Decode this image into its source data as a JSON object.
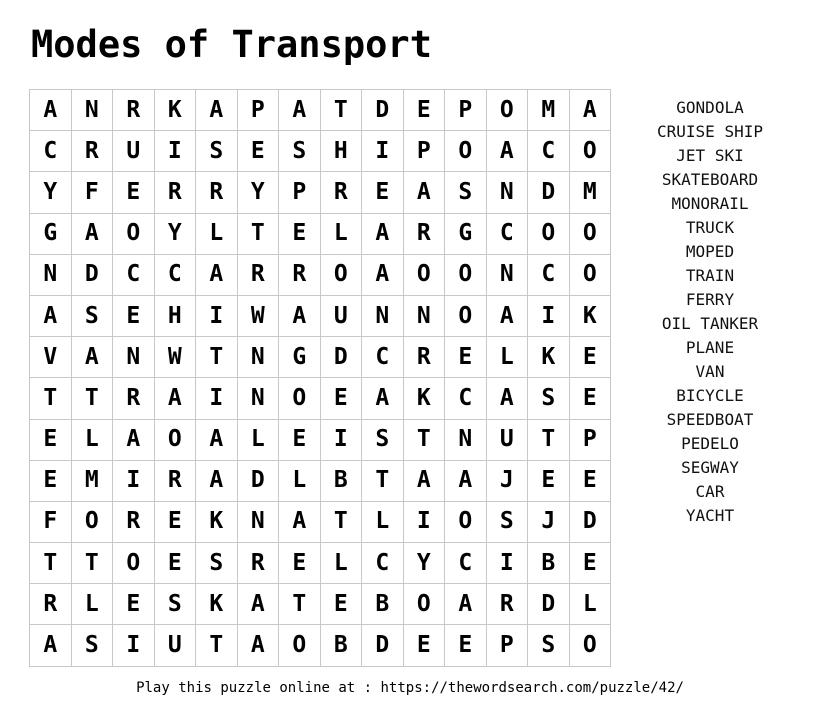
{
  "title": "Modes of Transport",
  "grid": [
    [
      "A",
      "N",
      "R",
      "K",
      "A",
      "P",
      "A",
      "T",
      "D",
      "E",
      "P",
      "O",
      "M",
      "A"
    ],
    [
      "C",
      "R",
      "U",
      "I",
      "S",
      "E",
      "S",
      "H",
      "I",
      "P",
      "O",
      "A",
      "C",
      "O"
    ],
    [
      "Y",
      "F",
      "E",
      "R",
      "R",
      "Y",
      "P",
      "R",
      "E",
      "A",
      "S",
      "N",
      "D",
      "M"
    ],
    [
      "G",
      "A",
      "O",
      "Y",
      "L",
      "T",
      "E",
      "L",
      "A",
      "R",
      "G",
      "C",
      "O",
      "O"
    ],
    [
      "N",
      "D",
      "C",
      "C",
      "A",
      "R",
      "R",
      "O",
      "A",
      "O",
      "O",
      "N",
      "C",
      "O"
    ],
    [
      "A",
      "S",
      "E",
      "H",
      "I",
      "W",
      "A",
      "U",
      "N",
      "N",
      "O",
      "A",
      "I",
      "K"
    ],
    [
      "V",
      "A",
      "N",
      "W",
      "T",
      "N",
      "G",
      "D",
      "C",
      "R",
      "E",
      "L",
      "K",
      "E"
    ],
    [
      "T",
      "T",
      "R",
      "A",
      "I",
      "N",
      "O",
      "E",
      "A",
      "K",
      "C",
      "A",
      "S",
      "E"
    ],
    [
      "E",
      "L",
      "A",
      "O",
      "A",
      "L",
      "E",
      "I",
      "S",
      "T",
      "N",
      "U",
      "T",
      "P"
    ],
    [
      "E",
      "M",
      "I",
      "R",
      "A",
      "D",
      "L",
      "B",
      "T",
      "A",
      "A",
      "J",
      "E",
      "E"
    ],
    [
      "F",
      "O",
      "R",
      "E",
      "K",
      "N",
      "A",
      "T",
      "L",
      "I",
      "O",
      "S",
      "J",
      "D"
    ],
    [
      "T",
      "T",
      "O",
      "E",
      "S",
      "R",
      "E",
      "L",
      "C",
      "Y",
      "C",
      "I",
      "B",
      "E"
    ],
    [
      "R",
      "L",
      "E",
      "S",
      "K",
      "A",
      "T",
      "E",
      "B",
      "O",
      "A",
      "R",
      "D",
      "L"
    ],
    [
      "A",
      "S",
      "I",
      "U",
      "T",
      "A",
      "O",
      "B",
      "D",
      "E",
      "E",
      "P",
      "S",
      "O"
    ]
  ],
  "words": [
    "GONDOLA",
    "CRUISE SHIP",
    "JET SKI",
    "SKATEBOARD",
    "MONORAIL",
    "TRUCK",
    "MOPED",
    "TRAIN",
    "FERRY",
    "OIL TANKER",
    "PLANE",
    "VAN",
    "BICYCLE",
    "SPEEDBOAT",
    "PEDELO",
    "SEGWAY",
    "CAR",
    "YACHT"
  ],
  "footer": {
    "text": "Play this puzzle online at : https://thewordsearch.com/puzzle/42/"
  },
  "colors": {
    "text": "#000000",
    "grid_border": "#c8c8c8",
    "background": "#ffffff"
  }
}
